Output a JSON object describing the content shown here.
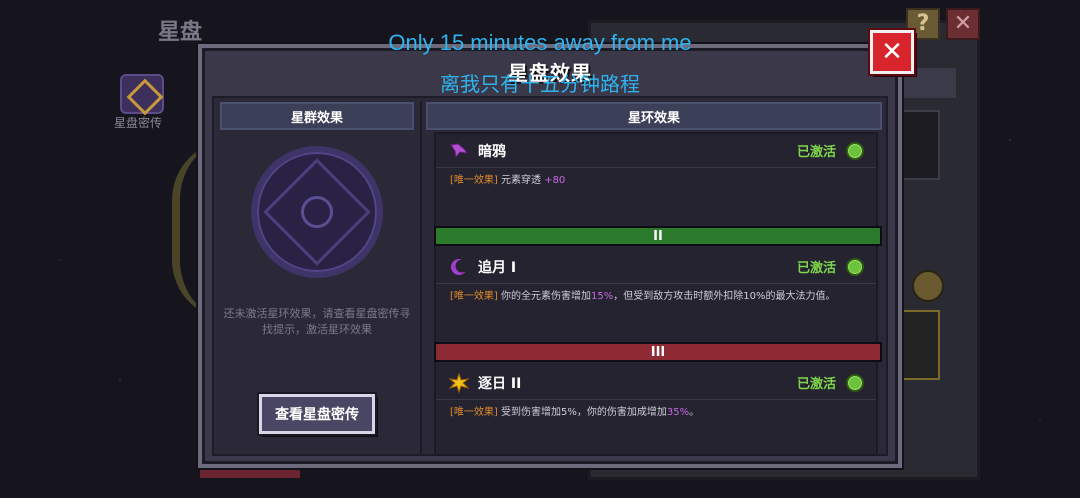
{
  "background": {
    "title": "星盘",
    "left_label": "星盘密传",
    "help_glyph": "?",
    "close_glyph": "✕"
  },
  "modal": {
    "title": "星盘效果",
    "close_glyph": "✕"
  },
  "left_section": {
    "header": "星群效果",
    "hint": "还未激活星环效果，请查看星盘密传寻找提示，激活星环效果",
    "view_button": "查看星盘密传"
  },
  "right_section": {
    "header": "星环效果",
    "rings": [
      {
        "icon": "crow-icon",
        "name": "暗鸦",
        "status": "已激活",
        "effect_tag": "[唯一效果]",
        "effect_text": "元素穿透",
        "effect_value": "+80"
      },
      {
        "icon": "crescent-icon",
        "name": "追月 I",
        "status": "已激活",
        "effect_tag": "[唯一效果]",
        "effect_text_1": "你的全元素伤害增加",
        "effect_value": "15%",
        "effect_text_2": "，但受到敌方攻击时额外扣除10%的最大法力值。"
      },
      {
        "icon": "sun-icon",
        "name": "逐日 II",
        "status": "已激活",
        "effect_tag": "[唯一效果]",
        "effect_text_1": "受到伤害增加5%，你的伤害加成增加",
        "effect_value": "35%",
        "effect_text_2": "。"
      }
    ],
    "tiers": [
      "II",
      "III"
    ]
  },
  "captions": {
    "english": "Only 15 minutes away from me",
    "chinese": "离我只有十五分钟路程"
  },
  "colors": {
    "active_green": "#7fd64a",
    "tag_orange": "#e08a2a",
    "highlight_purple": "#c56be0",
    "tier_green": "#2b7a2c",
    "tier_red": "#8e2a34",
    "close_red": "#d8242c",
    "caption_blue": "#2fb3ee"
  }
}
